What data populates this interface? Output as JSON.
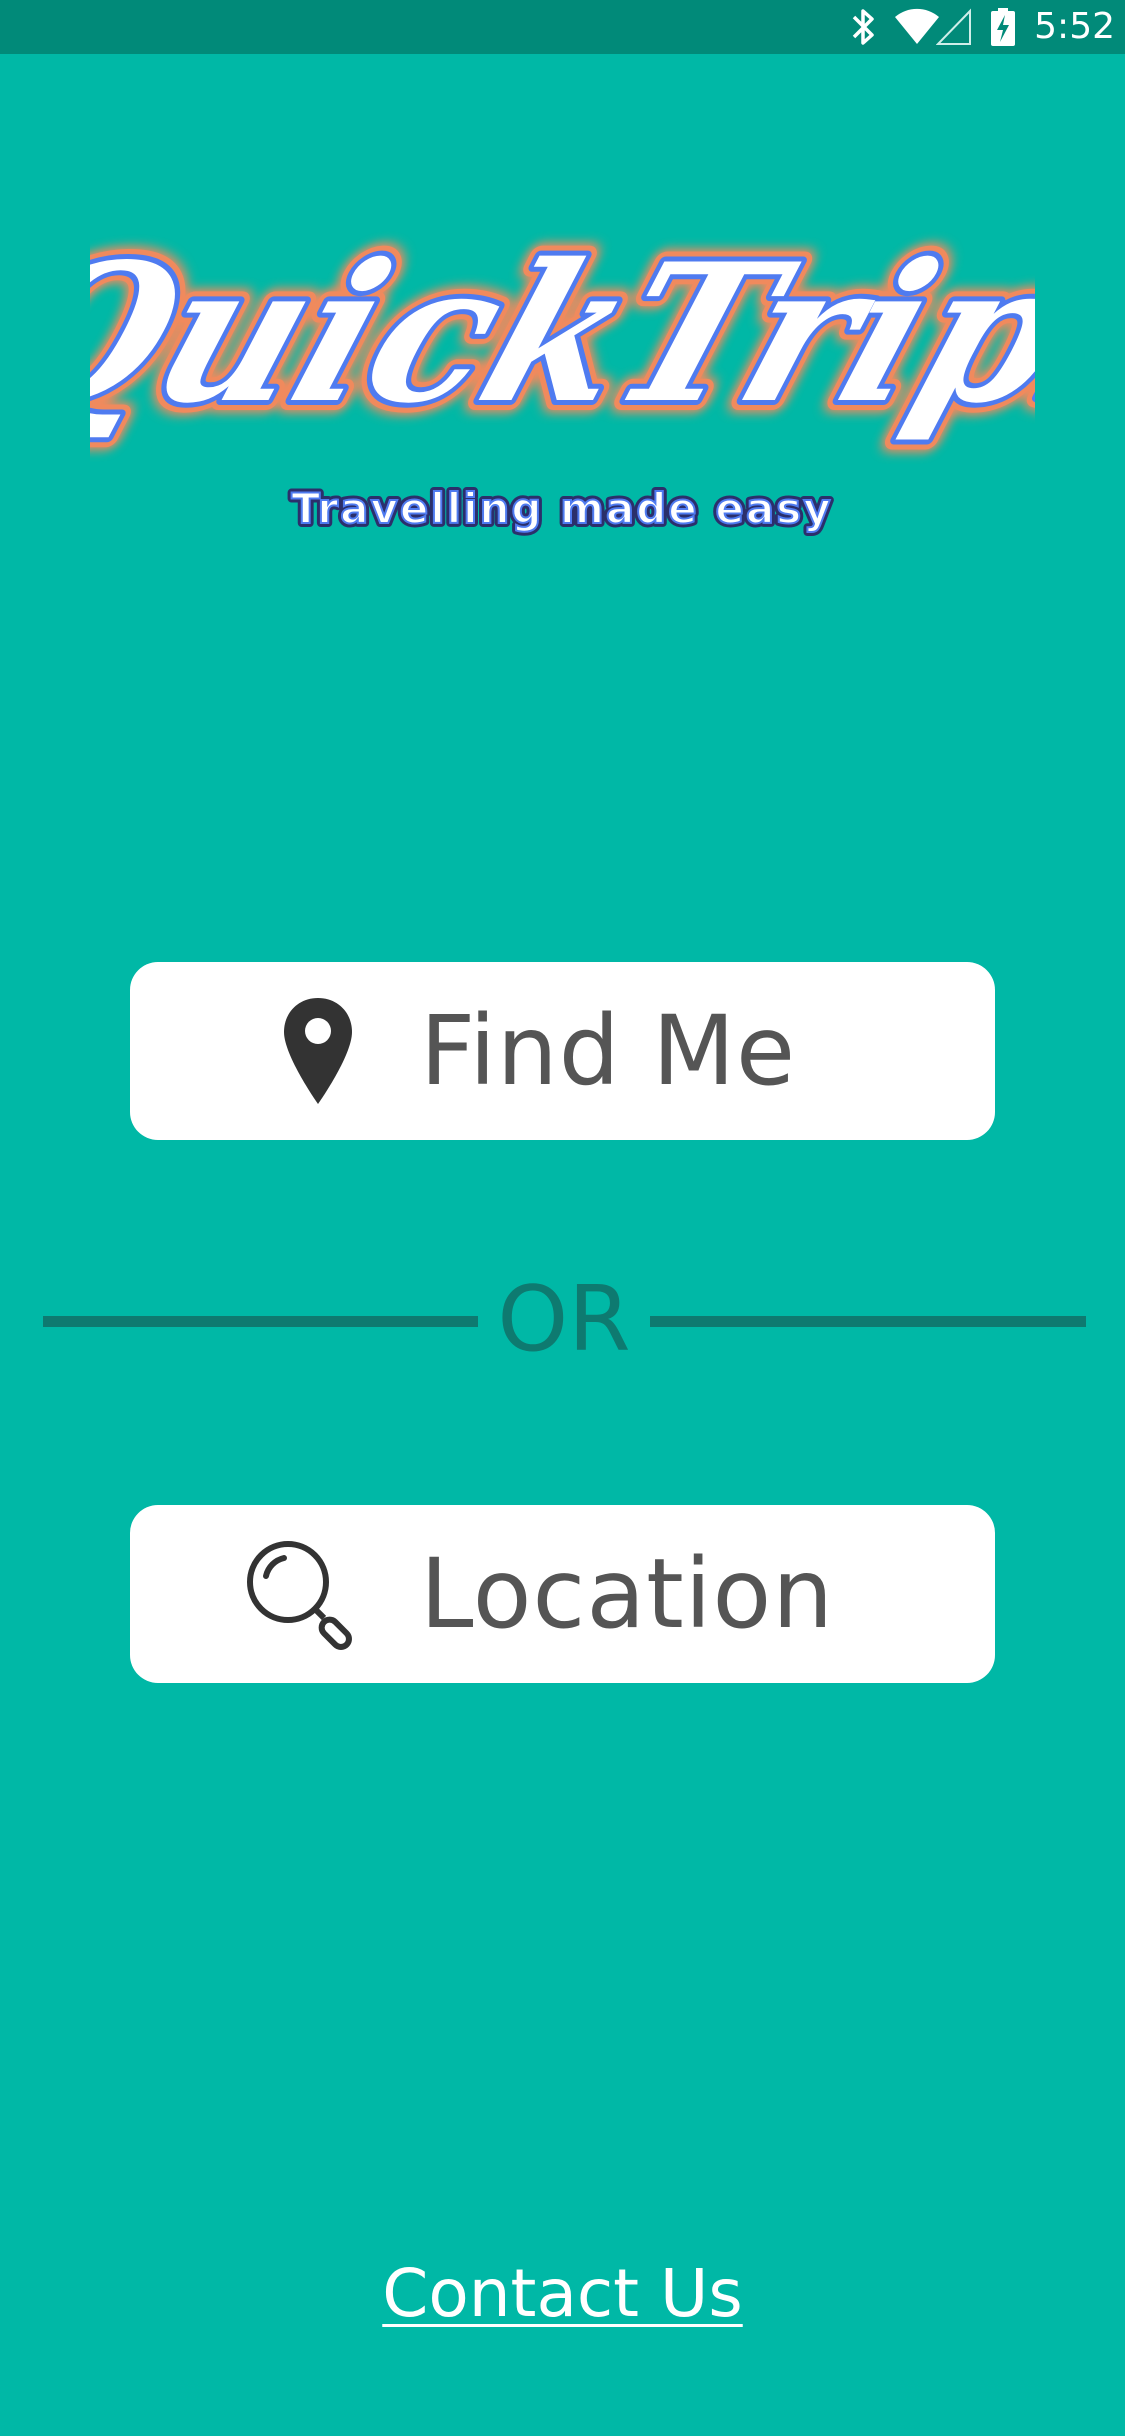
{
  "status_bar": {
    "time": "5:52",
    "icons": [
      "bluetooth-icon",
      "wifi-icon",
      "cell-signal-icon",
      "battery-charging-icon"
    ]
  },
  "logo": {
    "title": "QuickTrips",
    "tagline": "Travelling made easy"
  },
  "actions": {
    "find_me": {
      "label": "Find Me",
      "icon": "map-pin-icon"
    },
    "divider_text": "OR",
    "location": {
      "label": "Location",
      "icon": "search-icon"
    }
  },
  "footer": {
    "contact_label": "Contact Us"
  },
  "colors": {
    "background": "#00b8a6",
    "status_bar": "#018a79",
    "divider": "#0e7a70",
    "button_bg": "#ffffff",
    "button_text": "#555555",
    "logo_fill": "#ffffff",
    "logo_outline": "#4f7bf0",
    "logo_glow": "#f08a5d"
  }
}
